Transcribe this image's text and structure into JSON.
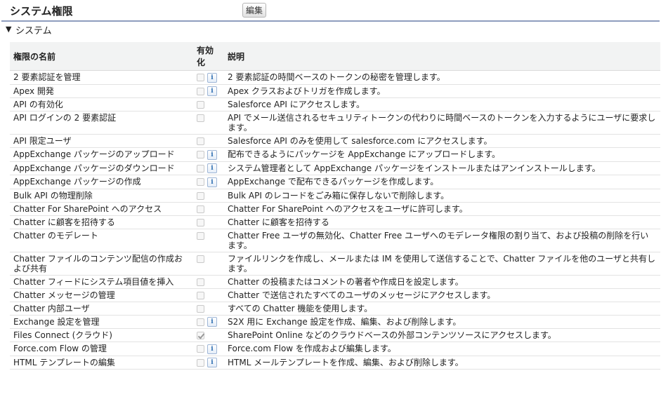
{
  "page": {
    "title": "システム権限",
    "edit_label": "編集"
  },
  "section": {
    "toggle": "▼",
    "title": "システム"
  },
  "table": {
    "headers": {
      "name": "権限の名前",
      "enabled": "有効化",
      "description": "説明"
    },
    "rows": [
      {
        "name": "2 要素認証を管理",
        "checked": false,
        "info": true,
        "description": "2 要素認証の時間ベースのトークンの秘密を管理します。"
      },
      {
        "name": "Apex 開発",
        "checked": false,
        "info": true,
        "description": "Apex クラスおよびトリガを作成します。"
      },
      {
        "name": "API の有効化",
        "checked": false,
        "info": false,
        "description": "Salesforce API にアクセスします。"
      },
      {
        "name": "API ログインの 2 要素認証",
        "checked": false,
        "info": false,
        "description": "API でメール送信されるセキュリティトークンの代わりに時間ベースのトークンを入力するようにユーザに要求します。"
      },
      {
        "name": "API 限定ユーザ",
        "checked": false,
        "info": false,
        "description": "Salesforce API のみを使用して salesforce.com にアクセスします。"
      },
      {
        "name": "AppExchange パッケージのアップロード",
        "checked": false,
        "info": true,
        "description": "配布できるようにパッケージを AppExchange にアップロードします。"
      },
      {
        "name": "AppExchange パッケージのダウンロード",
        "checked": false,
        "info": true,
        "description": "システム管理者として AppExchange パッケージをインストールまたはアンインストールします。"
      },
      {
        "name": "AppExchange パッケージの作成",
        "checked": false,
        "info": true,
        "description": "AppExchange で配布できるパッケージを作成します。"
      },
      {
        "name": "Bulk API の物理削除",
        "checked": false,
        "info": false,
        "description": "Bulk API のレコードをごみ箱に保存しないで削除します。"
      },
      {
        "name": "Chatter For SharePoint へのアクセス",
        "checked": false,
        "info": false,
        "description": "Chatter For SharePoint へのアクセスをユーザに許可します。"
      },
      {
        "name": "Chatter に顧客を招待する",
        "checked": false,
        "info": false,
        "description": "Chatter に顧客を招待する"
      },
      {
        "name": "Chatter のモデレート",
        "checked": false,
        "info": false,
        "description": "Chatter Free ユーザの無効化、Chatter Free ユーザへのモデレータ権限の割り当て、および投稿の削除を行います。"
      },
      {
        "name": "Chatter ファイルのコンテンツ配信の作成および共有",
        "checked": false,
        "info": false,
        "description": "ファイルリンクを作成し、メールまたは IM を使用して送信することで、Chatter ファイルを他のユーザと共有します。"
      },
      {
        "name": "Chatter フィードにシステム項目値を挿入",
        "checked": false,
        "info": false,
        "description": "Chatter の投稿またはコメントの著者や作成日を設定します。"
      },
      {
        "name": "Chatter メッセージの管理",
        "checked": false,
        "info": false,
        "description": "Chatter で送信されたすべてのユーザのメッセージにアクセスします。"
      },
      {
        "name": "Chatter 内部ユーザ",
        "checked": false,
        "info": false,
        "description": "すべての Chatter 機能を使用します。"
      },
      {
        "name": "Exchange 設定を管理",
        "checked": false,
        "info": true,
        "description": "S2X 用に Exchange 設定を作成、編集、および削除します。"
      },
      {
        "name": "Files Connect (クラウド)",
        "checked": true,
        "info": false,
        "description": "SharePoint Online などのクラウドベースの外部コンテンツソースにアクセスします。"
      },
      {
        "name": "Force.com Flow の管理",
        "checked": false,
        "info": true,
        "description": "Force.com Flow を作成および編集します。"
      },
      {
        "name": "HTML テンプレートの編集",
        "checked": false,
        "info": true,
        "description": "HTML メールテンプレートを作成、編集、および削除します。"
      }
    ]
  },
  "icons": {
    "info": "info-icon",
    "toggle": "triangle-down-icon"
  }
}
